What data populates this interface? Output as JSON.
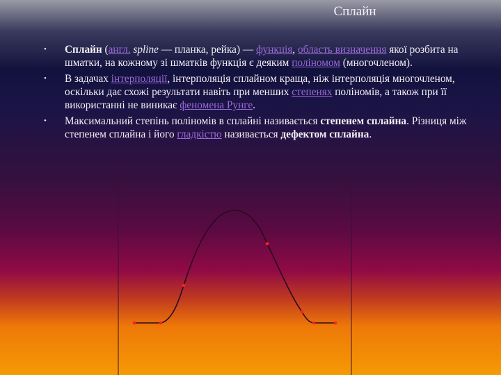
{
  "title": "Сплайн",
  "bullets": [
    {
      "p": [
        {
          "t": "Сплайн",
          "b": 1
        },
        {
          "t": " ("
        },
        {
          "t": "англ.",
          "a": 1
        },
        {
          "t": " "
        },
        {
          "t": "spline",
          "i": 1
        },
        {
          "t": " — планка, рейка) — "
        },
        {
          "t": "функція",
          "a": 1
        },
        {
          "t": ", "
        },
        {
          "t": "область визначення",
          "a": 1
        },
        {
          "t": " якої розбита на шматки, на кожному зі шматків функція є деяким "
        },
        {
          "t": "поліномом",
          "a": 1
        },
        {
          "t": " (многочленом)."
        }
      ]
    },
    {
      "p": [
        {
          "t": "В задачах "
        },
        {
          "t": "інтерполяції",
          "a": 1
        },
        {
          "t": ", інтерполяція сплайном краща, ніж інтерполяція многочленом, оскільки дає схожі результати навіть при менших "
        },
        {
          "t": "степенях",
          "a": 1
        },
        {
          "t": " поліномів, а також при її використанні не виникає "
        },
        {
          "t": "феномена Рунге",
          "a": 1
        },
        {
          "t": "."
        }
      ]
    },
    {
      "p": [
        {
          "t": "Максимальний степінь поліномів в сплайні називається "
        },
        {
          "t": "степенем сплайна",
          "b": 1
        },
        {
          "t": ". Різниця між степенем сплайна і його "
        },
        {
          "t": "гладкістю",
          "a": 1
        },
        {
          "t": " називається "
        },
        {
          "t": "дефектом сплайна",
          "b": 1
        },
        {
          "t": "."
        }
      ]
    }
  ],
  "colors": {
    "link": "#9a6ad8",
    "curve": "#2a0a20",
    "knot": "#ff2020"
  }
}
